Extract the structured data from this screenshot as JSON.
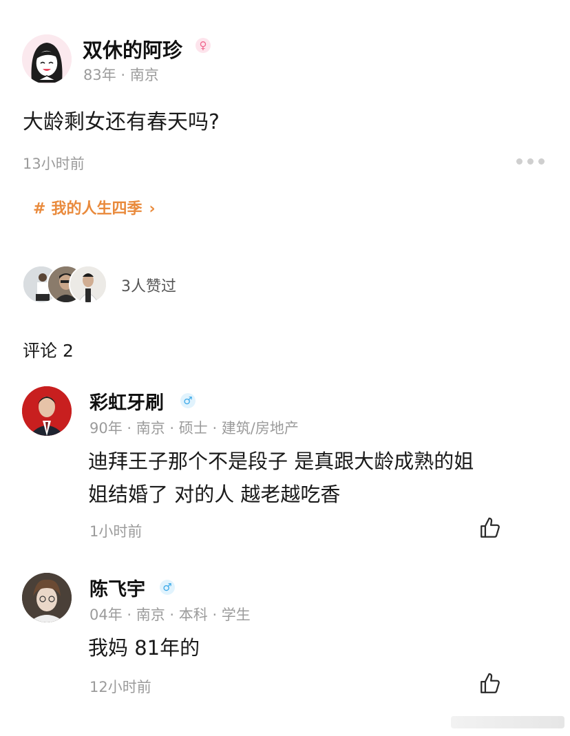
{
  "post": {
    "author": {
      "name": "双休的阿珍",
      "gender_symbol": "♀",
      "meta": "83年 · 南京"
    },
    "content": "大龄剩女还有春天吗?",
    "time": "13小时前",
    "topic": {
      "hash": "#",
      "label": "我的人生四季",
      "chevron": "›"
    },
    "likes_text": "3人赞过"
  },
  "comments_header": "评论 2",
  "comments": [
    {
      "name": "彩虹牙刷",
      "gender_symbol": "♂",
      "meta": "90年 · 南京 · 硕士 · 建筑/房地产",
      "text_line1": "迪拜王子那个不是段子 是真跟大龄成熟的姐",
      "text_line2": "姐结婚了 对的人 越老越吃香",
      "time": "1小时前",
      "like_icon": "thumbs-up-icon"
    },
    {
      "name": "陈飞宇",
      "gender_symbol": "♂",
      "meta": "04年 · 南京 · 本科 · 学生",
      "text_line1": "我妈 81年的",
      "time": "12小时前",
      "like_icon": "thumbs-up-icon"
    }
  ],
  "colors": {
    "topic": "#e98a3c",
    "meta_gray": "#9b9b9b",
    "female": "#f0648c",
    "male": "#3aa8e8"
  }
}
